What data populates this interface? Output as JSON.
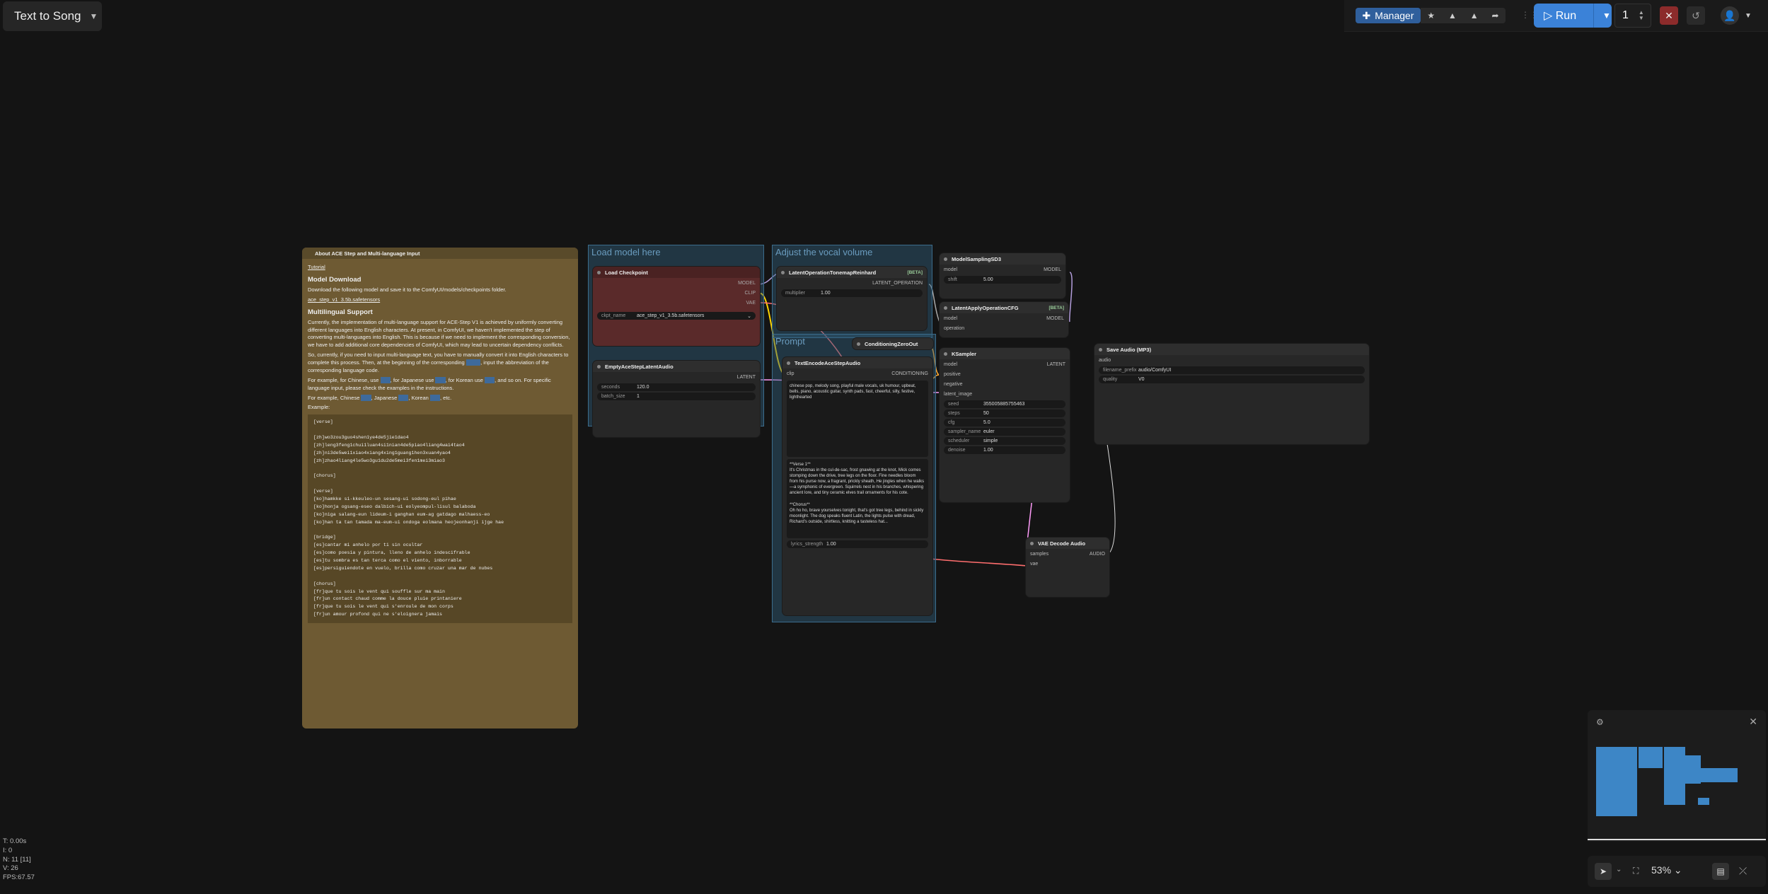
{
  "workflow": {
    "title": "Text to Song"
  },
  "toolbar": {
    "manager_label": "Manager",
    "run_label": "Run",
    "queue_count": "1"
  },
  "groups": {
    "load_model": "Load model here",
    "vocal_volume": "Adjust the vocal volume",
    "prompt": "Prompt"
  },
  "note": {
    "title": "About ACE Step and Multi-language Input",
    "tutorial_link": "Tutorial",
    "h_model_download": "Model Download",
    "p_download": "Download the following model and save it to the ComfyUI/models/checkpoints folder.",
    "model_link": "ace_step_v1_3.5b.safetensors",
    "h_multilingual": "Multilingual Support",
    "p1": "Currently, the implementation of multi-language support for ACE-Step V1 is achieved by uniformly converting different languages into English characters. At present, in ComfyUI, we haven't implemented the step of converting multi-languages into English. This is because if we need to implement the corresponding conversion, we have to add additional core dependencies of ComfyUI, which may lead to uncertain dependency conflicts.",
    "p2a": "So, currently, if you need to input multi-language text, you have to manually convert it into English characters to complete this process. Then, at the beginning of the corresponding",
    "p2b": ", input the abbreviation of the corresponding language code.",
    "p3a": "For example, for Chinese, use",
    "p3b": ", for Japanese use",
    "p3c": ", for Korean use",
    "p3d": ", and so on. For specific language input, please check the examples in the instructions.",
    "p4a": "For example, Chinese",
    "p4b": ", Japanese",
    "p4c": ", Korean",
    "p4d": ", etc.",
    "example_label": "Example:",
    "example_lines": [
      "[verse]",
      "",
      "[zh]wo3zou3guo4shen1ye4de5jie1dao4",
      "[zh]leng3feng1chui1luan4si1nian4de5piao4liang4wai4tao4",
      "[zh]ni3de5wei1xiao4xiang4xing1guang1hen3xuan4yao4",
      "[zh]zhao4liang4le5wo3gu1du2de5mei3fen1mei3miao3",
      "",
      "[chorus]",
      "",
      "[verse]",
      "[ko]hamkke si-kkeuleo-un sesang-ui sodong-eul pihae",
      "[ko]honja ogsang-eseo dalbich-ui eolyeompul-lisul balaboda",
      "[ko]niga salang-eun lideum-i ganghan eum-ag gatdago malhaess-eo",
      "[ko]han ta tan tamada ma-eum-ui ondoga eolmana heojeonhanji ijge hae",
      "",
      "[bridge]",
      "[es]cantar mi anhelo por ti sin ocultar",
      "[es]como poesia y pintura, lleno de anhelo indescifrable",
      "[es]tu sombra es tan terca como el viento, inborrable",
      "[es]persiguiendote en vuelo, brilla como cruzar una mar de nubes",
      "",
      "[chorus]",
      "[fr]que tu sois le vent qui souffle sur ma main",
      "[fr]un contact chaud comme la douce pluie printaniere",
      "[fr]que tu sois le vent qui s'enroule de mon corps",
      "[fr]un amour profond qui ne s'eloignera jamais"
    ]
  },
  "nodes": {
    "load_checkpoint": {
      "title": "Load Checkpoint",
      "out_model": "MODEL",
      "out_clip": "CLIP",
      "out_vae": "VAE",
      "ckpt_key": "ckpt_name",
      "ckpt_val": "ace_step_v1_3.5b.safetensors"
    },
    "empty_latent": {
      "title": "EmptyAceStepLatentAudio",
      "out": "LATENT",
      "seconds_key": "seconds",
      "seconds_val": "120.0",
      "batch_key": "batch_size",
      "batch_val": "1"
    },
    "latent_tonemap": {
      "title": "LatentOperationTonemapReinhard",
      "badge": "[BETA]",
      "out": "LATENT_OPERATION",
      "mult_key": "multiplier",
      "mult_val": "1.00"
    },
    "text_encode": {
      "title": "TextEncodeAceStepAudio",
      "in_clip": "clip",
      "out": "CONDITIONING",
      "tags": "chinese pop, melody song, playful male vocals, uk humour, upbeat, bells, piano, acoustic guitar, synth pads, fast, cheerful, silly, festive, lighthearted",
      "lyrics": "**Verse 1**\nIt's Christmas in the cul-de-sac, frost gnawing at the knot, Mick comes stomping down the drive, tree legs on the floor. Fine needles bloom from his purse now, a fragrant, prickly sheath, He jingles when he walks—a symphonic of evergreen. Squirrels nest in his branches, whispering ancient lore, and tiny ceramic elves trail ornaments for his cote.\n\n**Chorus**\nOh ho ho, brave yourselves tonight, that's got tree legs, behind in sickly moonlight. The dog speaks fluent Latin, the lights pulse with dread, Richard's outside, shirtless, knitting a tasteless hat...",
      "strength_key": "lyrics_strength",
      "strength_val": "1.00"
    },
    "cond_zero": {
      "title": "ConditioningZeroOut"
    },
    "model_sampling": {
      "title": "ModelSamplingSD3",
      "in_model": "model",
      "out": "MODEL",
      "shift_key": "shift",
      "shift_val": "5.00"
    },
    "latent_apply": {
      "title": "LatentApplyOperationCFG",
      "badge": "[BETA]",
      "in_model": "model",
      "in_op": "operation",
      "out": "MODEL"
    },
    "ksampler": {
      "title": "KSampler",
      "in_model": "model",
      "in_pos": "positive",
      "in_neg": "negative",
      "in_latent": "latent_image",
      "out": "LATENT",
      "seed_key": "seed",
      "seed_val": "355005885755463",
      "steps_key": "steps",
      "steps_val": "50",
      "cfg_key": "cfg",
      "cfg_val": "5.0",
      "sampler_key": "sampler_name",
      "sampler_val": "euler",
      "scheduler_key": "scheduler",
      "scheduler_val": "simple",
      "denoise_key": "denoise",
      "denoise_val": "1.00"
    },
    "vae_decode": {
      "title": "VAE Decode Audio",
      "in_samples": "samples",
      "in_vae": "vae",
      "out": "AUDIO"
    },
    "save_audio": {
      "title": "Save Audio (MP3)",
      "in_audio": "audio",
      "prefix_key": "filename_prefix",
      "prefix_val": "audio/ComfyUI",
      "quality_key": "quality",
      "quality_val": "V0"
    }
  },
  "zoom": {
    "label": "53%"
  },
  "stats": {
    "t": "T: 0.00s",
    "i": "I: 0",
    "n": "N: 11 [11]",
    "v": "V: 26",
    "fps": "FPS:67.57"
  },
  "colors": {
    "accent": "#3b82d8",
    "group": "#305f7d",
    "note": "#6e5a33",
    "stop": "#8c2b2b"
  }
}
